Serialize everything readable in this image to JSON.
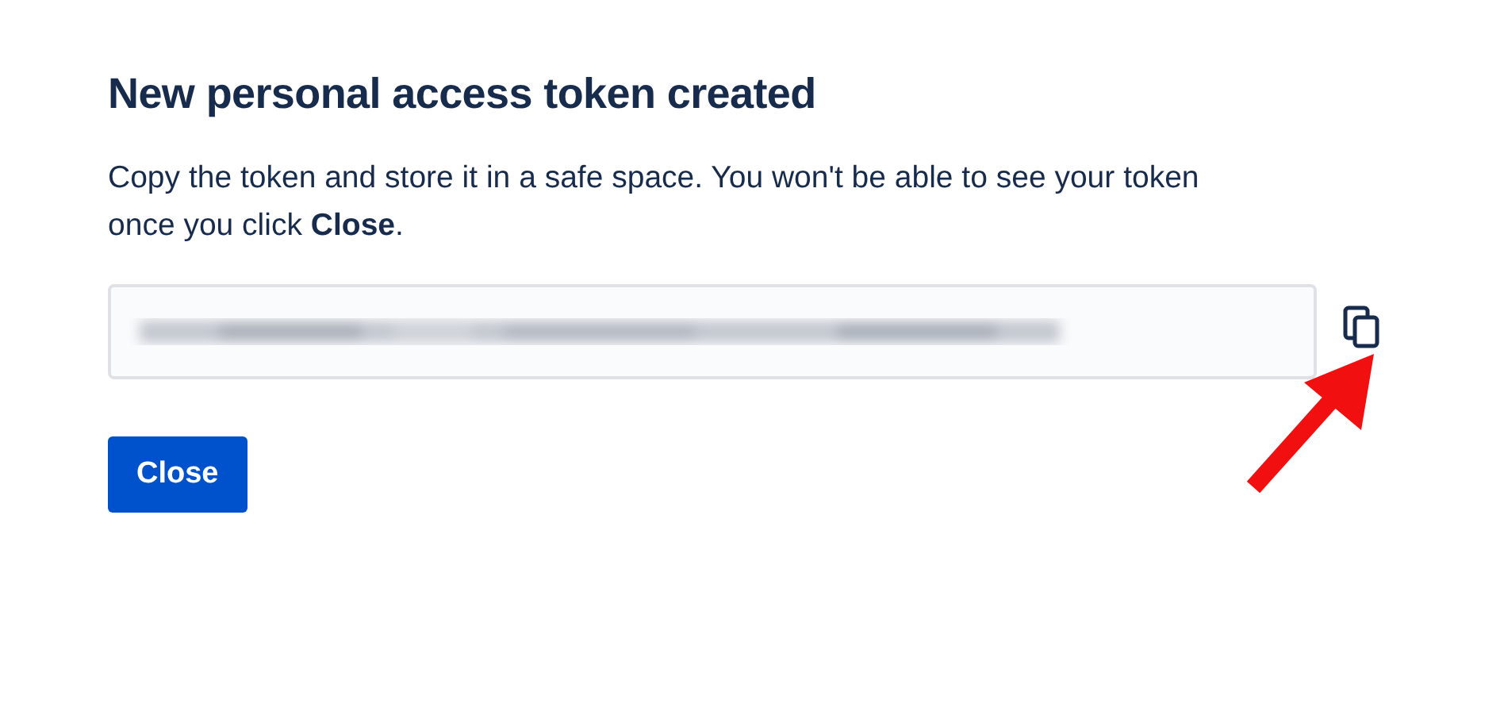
{
  "dialog": {
    "title": "New personal access token created",
    "message": "Copy the token and store it in a safe space. You won't be able to see your token once you click **Close**.",
    "buttons": [
      {
        "label": "Close",
        "kind": "primary"
      }
    ]
  }
}
